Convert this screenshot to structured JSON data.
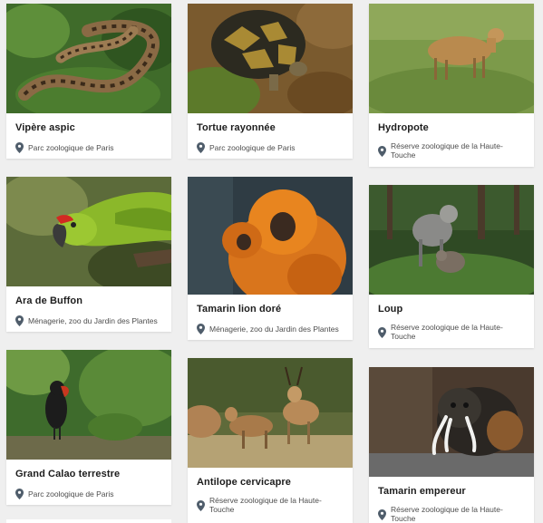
{
  "colors": {
    "background": "#efefef",
    "card": "#ffffff",
    "title": "#1d1d1d",
    "location": "#4d4d4d",
    "pin": "#4f5d6b"
  },
  "cards": [
    {
      "name": "Vipère aspic",
      "location": "Parc zoologique de Paris"
    },
    {
      "name": "Tortue rayonnée",
      "location": "Parc zoologique de Paris"
    },
    {
      "name": "Hydropote",
      "location": "Réserve zoologique de la Haute-Touche"
    },
    {
      "name": "Ara de Buffon",
      "location": "Ménagerie, zoo du Jardin des Plantes"
    },
    {
      "name": "Tamarin lion doré",
      "location": "Ménagerie, zoo du Jardin des Plantes"
    },
    {
      "name": "Loup",
      "location": "Réserve zoologique de la Haute-Touche"
    },
    {
      "name": "Grand Calao terrestre",
      "location": "Parc zoologique de Paris"
    },
    {
      "name": "Antilope cervicapre",
      "location": "Réserve zoologique de la Haute-Touche"
    },
    {
      "name": "Tamarin empereur",
      "location": "Réserve zoologique de la Haute-Touche"
    }
  ]
}
